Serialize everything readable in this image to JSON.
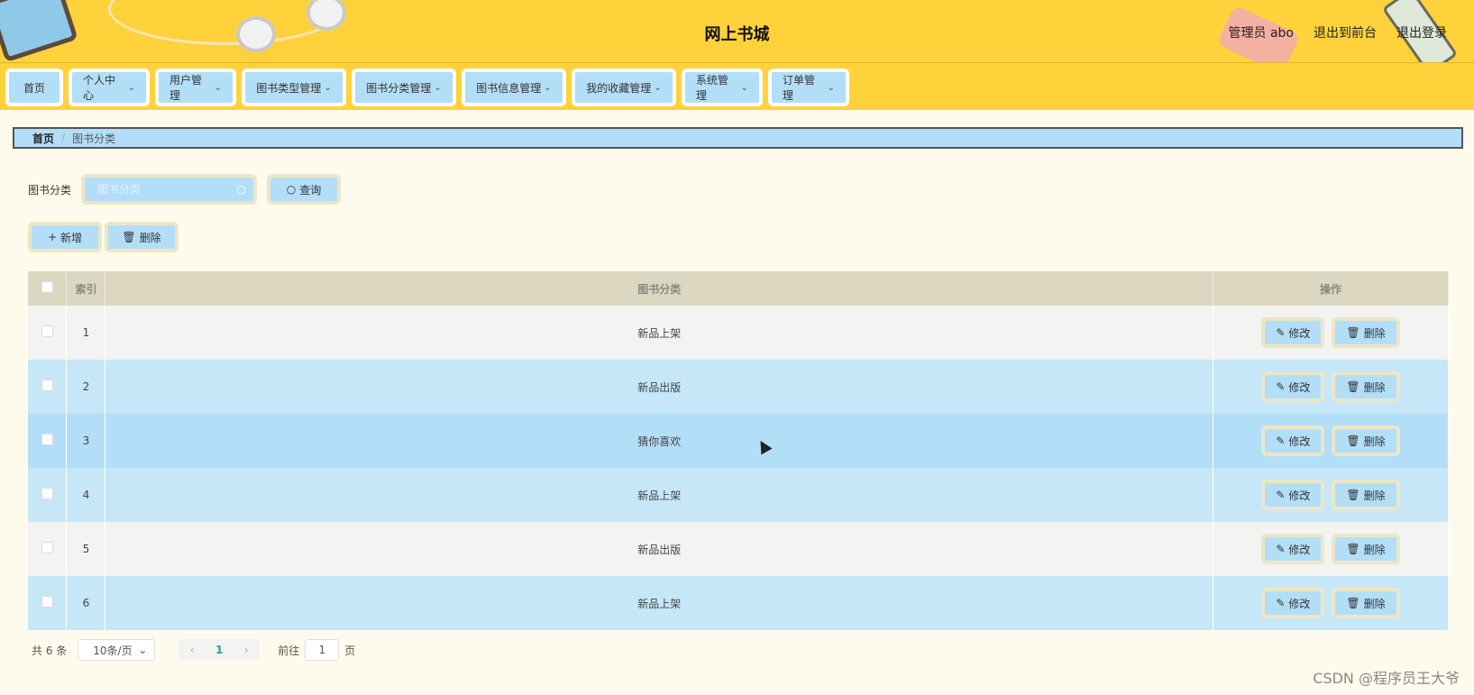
{
  "header": {
    "title": "网上书城",
    "user": "管理员 abo",
    "link_front": "退出到前台",
    "link_logout": "退出登录"
  },
  "nav": {
    "items": [
      {
        "label": "首页",
        "dropdown": false
      },
      {
        "label": "个人中心",
        "dropdown": true
      },
      {
        "label": "用户管理",
        "dropdown": true
      },
      {
        "label": "图书类型管理",
        "dropdown": true
      },
      {
        "label": "图书分类管理",
        "dropdown": true
      },
      {
        "label": "图书信息管理",
        "dropdown": true
      },
      {
        "label": "我的收藏管理",
        "dropdown": true
      },
      {
        "label": "系统管理",
        "dropdown": true
      },
      {
        "label": "订单管理",
        "dropdown": true
      }
    ]
  },
  "breadcrumb": {
    "home": "首页",
    "separator": "/",
    "current": "图书分类"
  },
  "search": {
    "label": "图书分类",
    "placeholder": "图书分类",
    "button": "查询"
  },
  "actions": {
    "add": "新增",
    "delete": "删除"
  },
  "table": {
    "columns": [
      "索引",
      "图书分类",
      "操作"
    ],
    "rows": [
      {
        "index": "1",
        "category": "新品上架"
      },
      {
        "index": "2",
        "category": "新品出版"
      },
      {
        "index": "3",
        "category": "猜你喜欢"
      },
      {
        "index": "4",
        "category": "新品上架"
      },
      {
        "index": "5",
        "category": "新品出版"
      },
      {
        "index": "6",
        "category": "新品上架"
      }
    ],
    "edit_label": "修改",
    "delete_label": "删除"
  },
  "pagination": {
    "total": "共 6 条",
    "page_size": "10条/页",
    "current_page": "1",
    "goto_prefix": "前往",
    "goto_value": "1",
    "goto_suffix": "页"
  },
  "watermark": "CSDN @程序员王大爷",
  "colors": {
    "header_bg": "#ffd23c",
    "button_bg": "#b3def7",
    "table_header_bg": "#dbd7c0",
    "page_bg": "#fffbec"
  }
}
